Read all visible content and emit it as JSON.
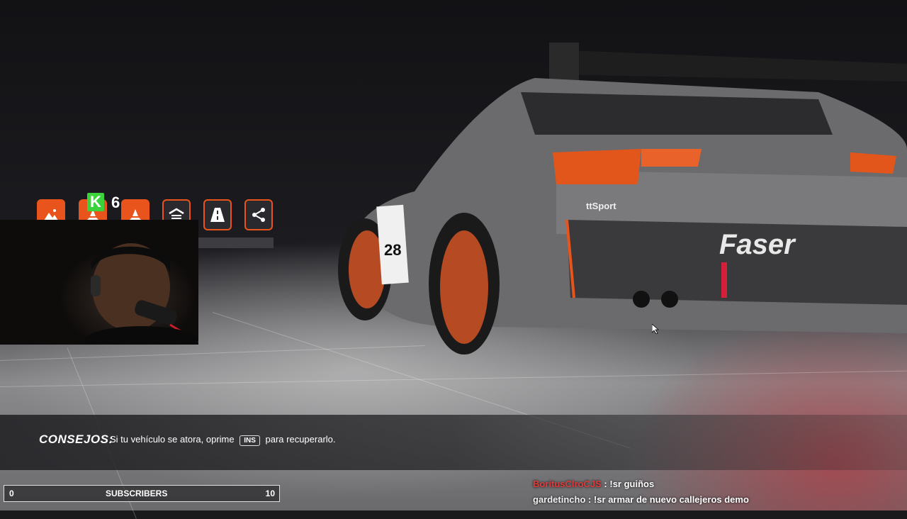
{
  "toolbar": {
    "icons": [
      {
        "name": "landscape-icon"
      },
      {
        "name": "traffic-cone-icon"
      },
      {
        "name": "traffic-cone-icon"
      },
      {
        "name": "garage-icon"
      },
      {
        "name": "road-icon"
      },
      {
        "name": "share-icon"
      }
    ],
    "kick_count": "6",
    "kick_letter": "K"
  },
  "car": {
    "number": "28",
    "livery_brand": "Faser",
    "sponsor": "ttSport"
  },
  "tips": {
    "title": "CONSEJOS:",
    "text_before": "Si tu vehículo se atora, oprime",
    "key": "INS",
    "text_after": "para recuperarlo."
  },
  "subscribers": {
    "current": "0",
    "label": "SUBSCRIBERS",
    "goal": "10"
  },
  "chat": {
    "messages": [
      {
        "user": "BoritusClroCJS",
        "text": ": !sr guiños",
        "user_color": "#e03a3a"
      },
      {
        "user": "gardetincho",
        "text": ": !sr armar de nuevo callejeros demo",
        "user_color": "#f0f0f0"
      }
    ]
  },
  "colors": {
    "accent": "#e8541c",
    "kick_green": "#3bd23b"
  }
}
